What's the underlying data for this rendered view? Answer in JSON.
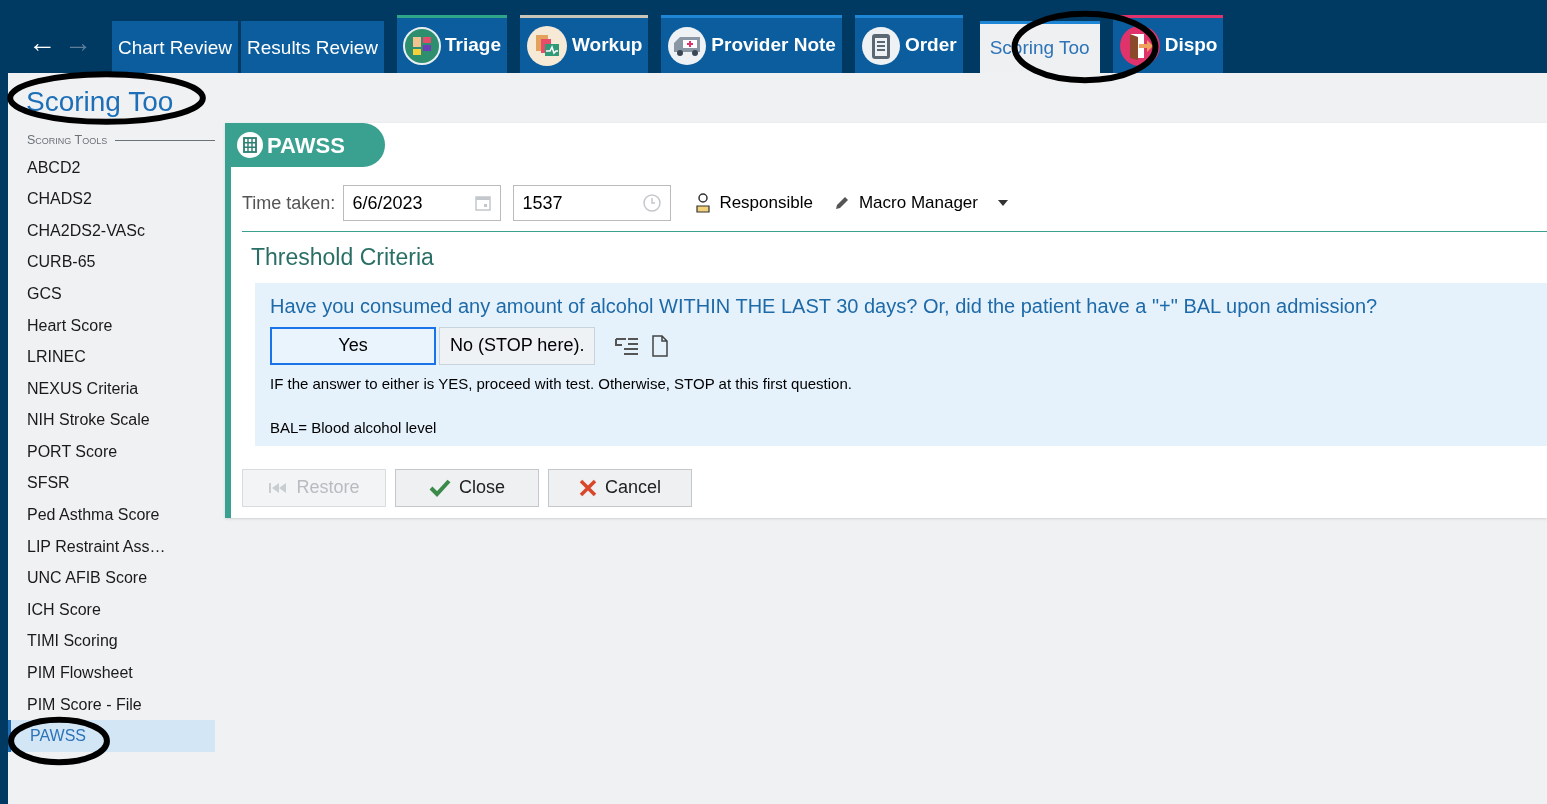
{
  "nav": {
    "back": "←",
    "forward": "→"
  },
  "tabs": [
    {
      "label": "Chart Review",
      "kind": "none",
      "selected": false,
      "color": "#0b5d9e"
    },
    {
      "label": "Results Review",
      "kind": "none",
      "selected": false,
      "color": "#0b5d9e"
    },
    {
      "label": "Triage",
      "kind": "triage",
      "selected": false,
      "color": "#2fa58a"
    },
    {
      "label": "Workup",
      "kind": "workup",
      "selected": false,
      "color": "#c9c4b8"
    },
    {
      "label": "Provider Note",
      "kind": "ambulance",
      "selected": false,
      "color": "#1f86d6"
    },
    {
      "label": "Order",
      "kind": "clipboard",
      "selected": false,
      "color": "#1f86d6"
    },
    {
      "label": "Scoring Too",
      "kind": "none",
      "selected": true,
      "color": "#1f86d6"
    },
    {
      "label": "Dispo",
      "kind": "door",
      "selected": false,
      "color": "#e0336b"
    }
  ],
  "page_title": "Scoring Too",
  "sidebar": {
    "heading": "Scoring Tools",
    "items": [
      {
        "label": "ABCD2",
        "selected": false
      },
      {
        "label": "CHADS2",
        "selected": false
      },
      {
        "label": "CHA2DS2-VASc",
        "selected": false
      },
      {
        "label": "CURB-65",
        "selected": false
      },
      {
        "label": "GCS",
        "selected": false
      },
      {
        "label": "Heart Score",
        "selected": false
      },
      {
        "label": "LRINEC",
        "selected": false
      },
      {
        "label": "NEXUS Criteria",
        "selected": false
      },
      {
        "label": "NIH Stroke Scale",
        "selected": false
      },
      {
        "label": "PORT Score",
        "selected": false
      },
      {
        "label": "SFSR",
        "selected": false
      },
      {
        "label": "Ped Asthma Score",
        "selected": false
      },
      {
        "label": "LIP Restraint Ass…",
        "selected": false
      },
      {
        "label": "UNC AFIB Score",
        "selected": false
      },
      {
        "label": "ICH Score",
        "selected": false
      },
      {
        "label": "TIMI Scoring",
        "selected": false
      },
      {
        "label": "PIM Flowsheet",
        "selected": false
      },
      {
        "label": "PIM Score - File",
        "selected": false
      },
      {
        "label": "PAWSS",
        "selected": true
      }
    ]
  },
  "form": {
    "title": "PAWSS",
    "time_label": "Time taken:",
    "date": "6/6/2023",
    "time": "1537",
    "responsible": "Responsible",
    "macro": "Macro Manager",
    "section": "Threshold Criteria",
    "question": "Have you consumed any amount of alcohol WITHIN THE LAST 30 days? Or, did the patient have a \"+\" BAL upon admission?",
    "answers": [
      {
        "label": "Yes",
        "selected": true
      },
      {
        "label": "No (STOP here).",
        "selected": false
      }
    ],
    "notes": [
      "IF the answer to either is YES, proceed with test. Otherwise, STOP at this first question.",
      "BAL= Blood alcohol level"
    ],
    "buttons": [
      {
        "label": "Restore",
        "kind": "restore",
        "disabled": true
      },
      {
        "label": "Close",
        "kind": "close",
        "disabled": false
      },
      {
        "label": "Cancel",
        "kind": "cancel",
        "disabled": false
      }
    ]
  }
}
